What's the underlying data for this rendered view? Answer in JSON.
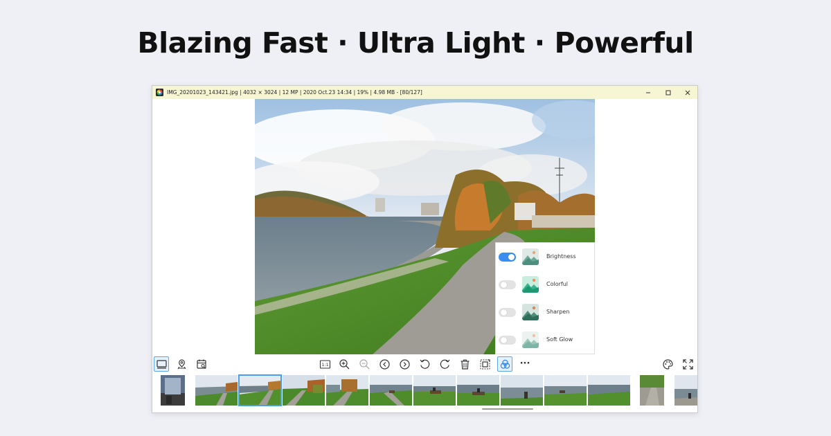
{
  "headline": "Blazing Fast · Ultra Light · Powerful",
  "window": {
    "title": "IMG_20201023_143421.jpg  |  4032 × 3024  |  12 MP  |  2020 Oct.23 14:34  |  19%  |  4.98 MB  -  [80/127]",
    "controls": [
      "minimize",
      "maximize",
      "close"
    ]
  },
  "adjustments": [
    {
      "label": "Brightness",
      "enabled": true
    },
    {
      "label": "Colorful",
      "enabled": false
    },
    {
      "label": "Sharpen",
      "enabled": false
    },
    {
      "label": "Soft Glow",
      "enabled": false
    }
  ],
  "toolbar": {
    "left": [
      "filmstrip-icon",
      "map-pin-icon",
      "calendar-search-icon"
    ],
    "center": [
      "actual-size-icon",
      "zoom-in-icon",
      "zoom-out-icon",
      "previous-icon",
      "next-icon",
      "rotate-left-icon",
      "rotate-right-icon",
      "delete-icon",
      "crop-icon",
      "filters-icon",
      "more-icon"
    ],
    "right": [
      "palette-icon",
      "fullscreen-icon"
    ],
    "actual_size_label": "1:1",
    "more_label": "···",
    "active": [
      "filmstrip-icon",
      "filters-icon"
    ]
  },
  "filmstrip": {
    "count": 13,
    "selected_index": 2
  },
  "colors": {
    "background": "#eff0f6",
    "titlebar": "#f6f6d5",
    "accent": "#3a8ef0"
  }
}
